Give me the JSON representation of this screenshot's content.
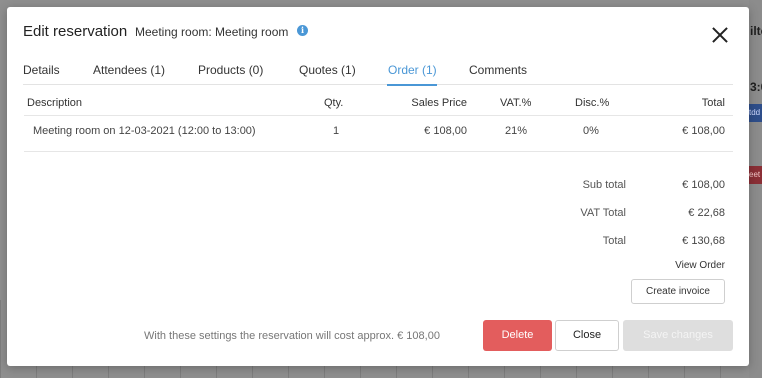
{
  "background": {
    "partial_text_1": "3:0",
    "partial_text_2": "ilte",
    "chip_blue": "tdd",
    "chip_red": "eet"
  },
  "modal": {
    "title": "Edit reservation",
    "subtitle": "Meeting room: Meeting room",
    "info_icon": "i"
  },
  "tabs": [
    {
      "label": "Details"
    },
    {
      "label": "Attendees (1)"
    },
    {
      "label": "Products (0)"
    },
    {
      "label": "Quotes (1)"
    },
    {
      "label": "Order (1)"
    },
    {
      "label": "Comments"
    }
  ],
  "active_tab": "Order (1)",
  "table": {
    "headers": {
      "description": "Description",
      "qty": "Qty.",
      "sales_price": "Sales Price",
      "vat": "VAT.%",
      "disc": "Disc.%",
      "total": "Total"
    },
    "rows": [
      {
        "description": "Meeting room on 12-03-2021 (12:00 to 13:00)",
        "qty": "1",
        "sales_price": "€ 108,00",
        "vat": "21%",
        "disc": "0%",
        "total": "€ 108,00"
      }
    ]
  },
  "totals": {
    "sub_total_label": "Sub total",
    "sub_total_value": "€ 108,00",
    "vat_total_label": "VAT Total",
    "vat_total_value": "€ 22,68",
    "total_label": "Total",
    "total_value": "€ 130,68"
  },
  "links": {
    "view_order": "View Order"
  },
  "buttons": {
    "create_invoice": "Create invoice",
    "delete": "Delete",
    "close": "Close",
    "save": "Save changes"
  },
  "footer_note": "With these settings the reservation will cost approx. € 108,00",
  "colors": {
    "accent": "#4a97d6",
    "danger": "#e35d5d",
    "disabled": "#dedede"
  }
}
